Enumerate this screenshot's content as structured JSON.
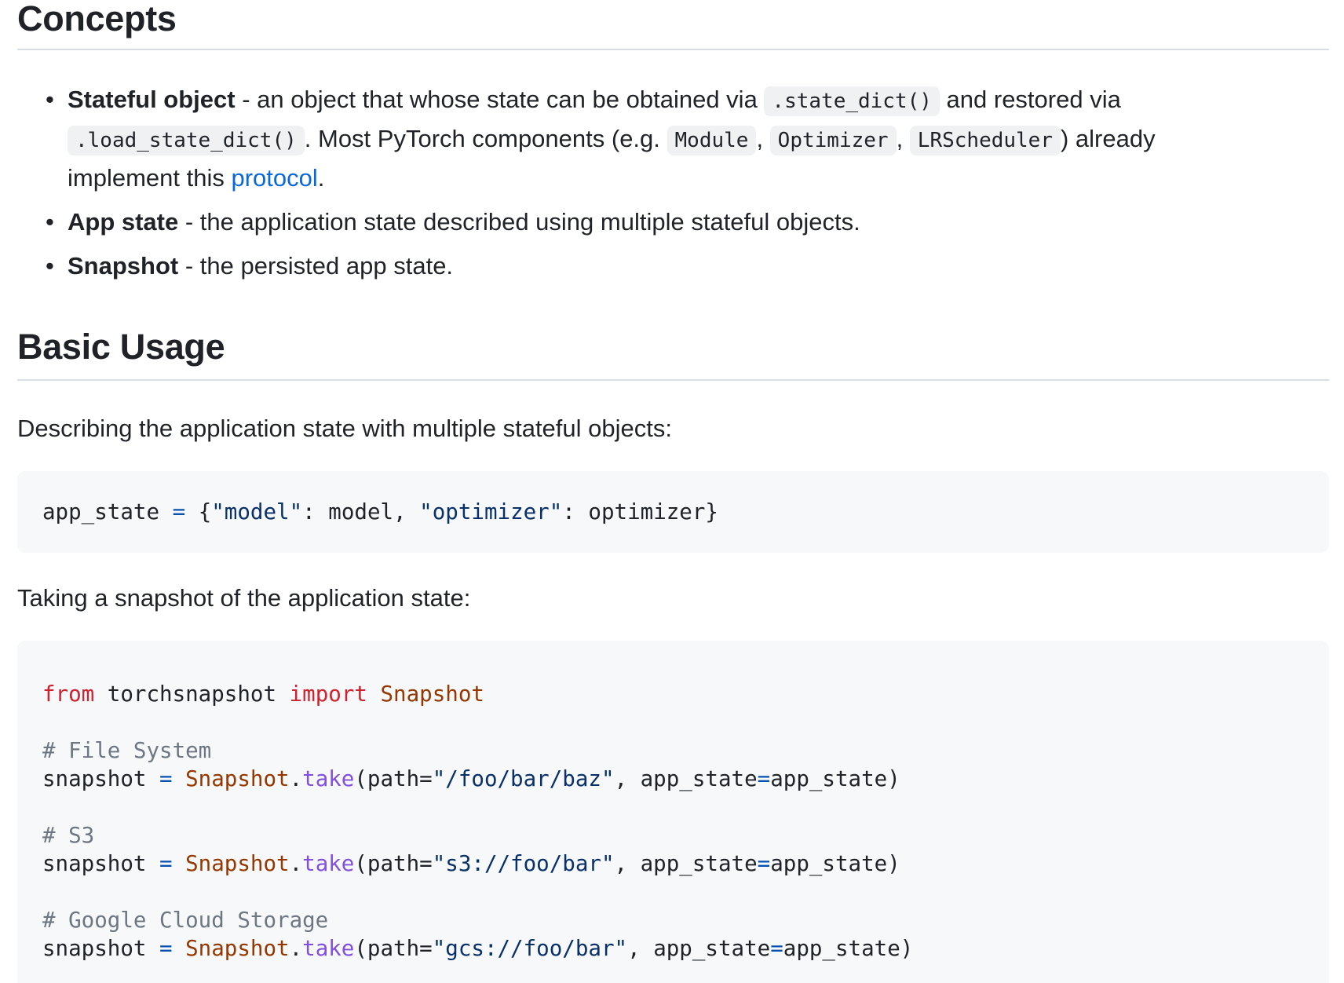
{
  "concepts": {
    "heading": "Concepts",
    "items": [
      {
        "term": "Stateful object",
        "sep": " - an object that whose state can be obtained via ",
        "code1": ".state_dict()",
        "mid": " and restored via",
        "code2": ".load_state_dict()",
        "text2": ". Most PyTorch components (e.g. ",
        "code_module": "Module",
        "comma1": ", ",
        "code_optimizer": "Optimizer",
        "comma2": ", ",
        "code_lrscheduler": "LRScheduler",
        "text3": ") already",
        "text4": "implement this ",
        "link": "protocol",
        "period": "."
      },
      {
        "term": "App state",
        "desc": " - the application state described using multiple stateful objects."
      },
      {
        "term": "Snapshot",
        "desc": " - the persisted app state."
      }
    ]
  },
  "basic_usage": {
    "heading": "Basic Usage",
    "intro1": "Describing the application state with multiple stateful objects:",
    "code1": {
      "var": "app_state",
      "eq": " = ",
      "open": "{",
      "key1": "\"model\"",
      "colon1": ": model, ",
      "key2": "\"optimizer\"",
      "colon2": ": optimizer}"
    },
    "intro2": "Taking a snapshot of the application state:",
    "code2": {
      "import_from": "from",
      "module": " torchsnapshot ",
      "import_kw": "import",
      "import_cls": " Snapshot",
      "comment_fs": "# File System",
      "comment_s3": "# S3",
      "comment_gcs": "# Google Cloud Storage",
      "var": "snapshot",
      "eq": " = ",
      "cls": "Snapshot",
      "dot": ".",
      "method": "take",
      "path_open": "(path=",
      "path_fs": "\"/foo/bar/baz\"",
      "path_s3": "\"s3://foo/bar\"",
      "path_gcs": "\"gcs://foo/bar\"",
      "arg_tail": ", app_state",
      "kw_eq": "=",
      "arg_val": "app_state)"
    }
  }
}
